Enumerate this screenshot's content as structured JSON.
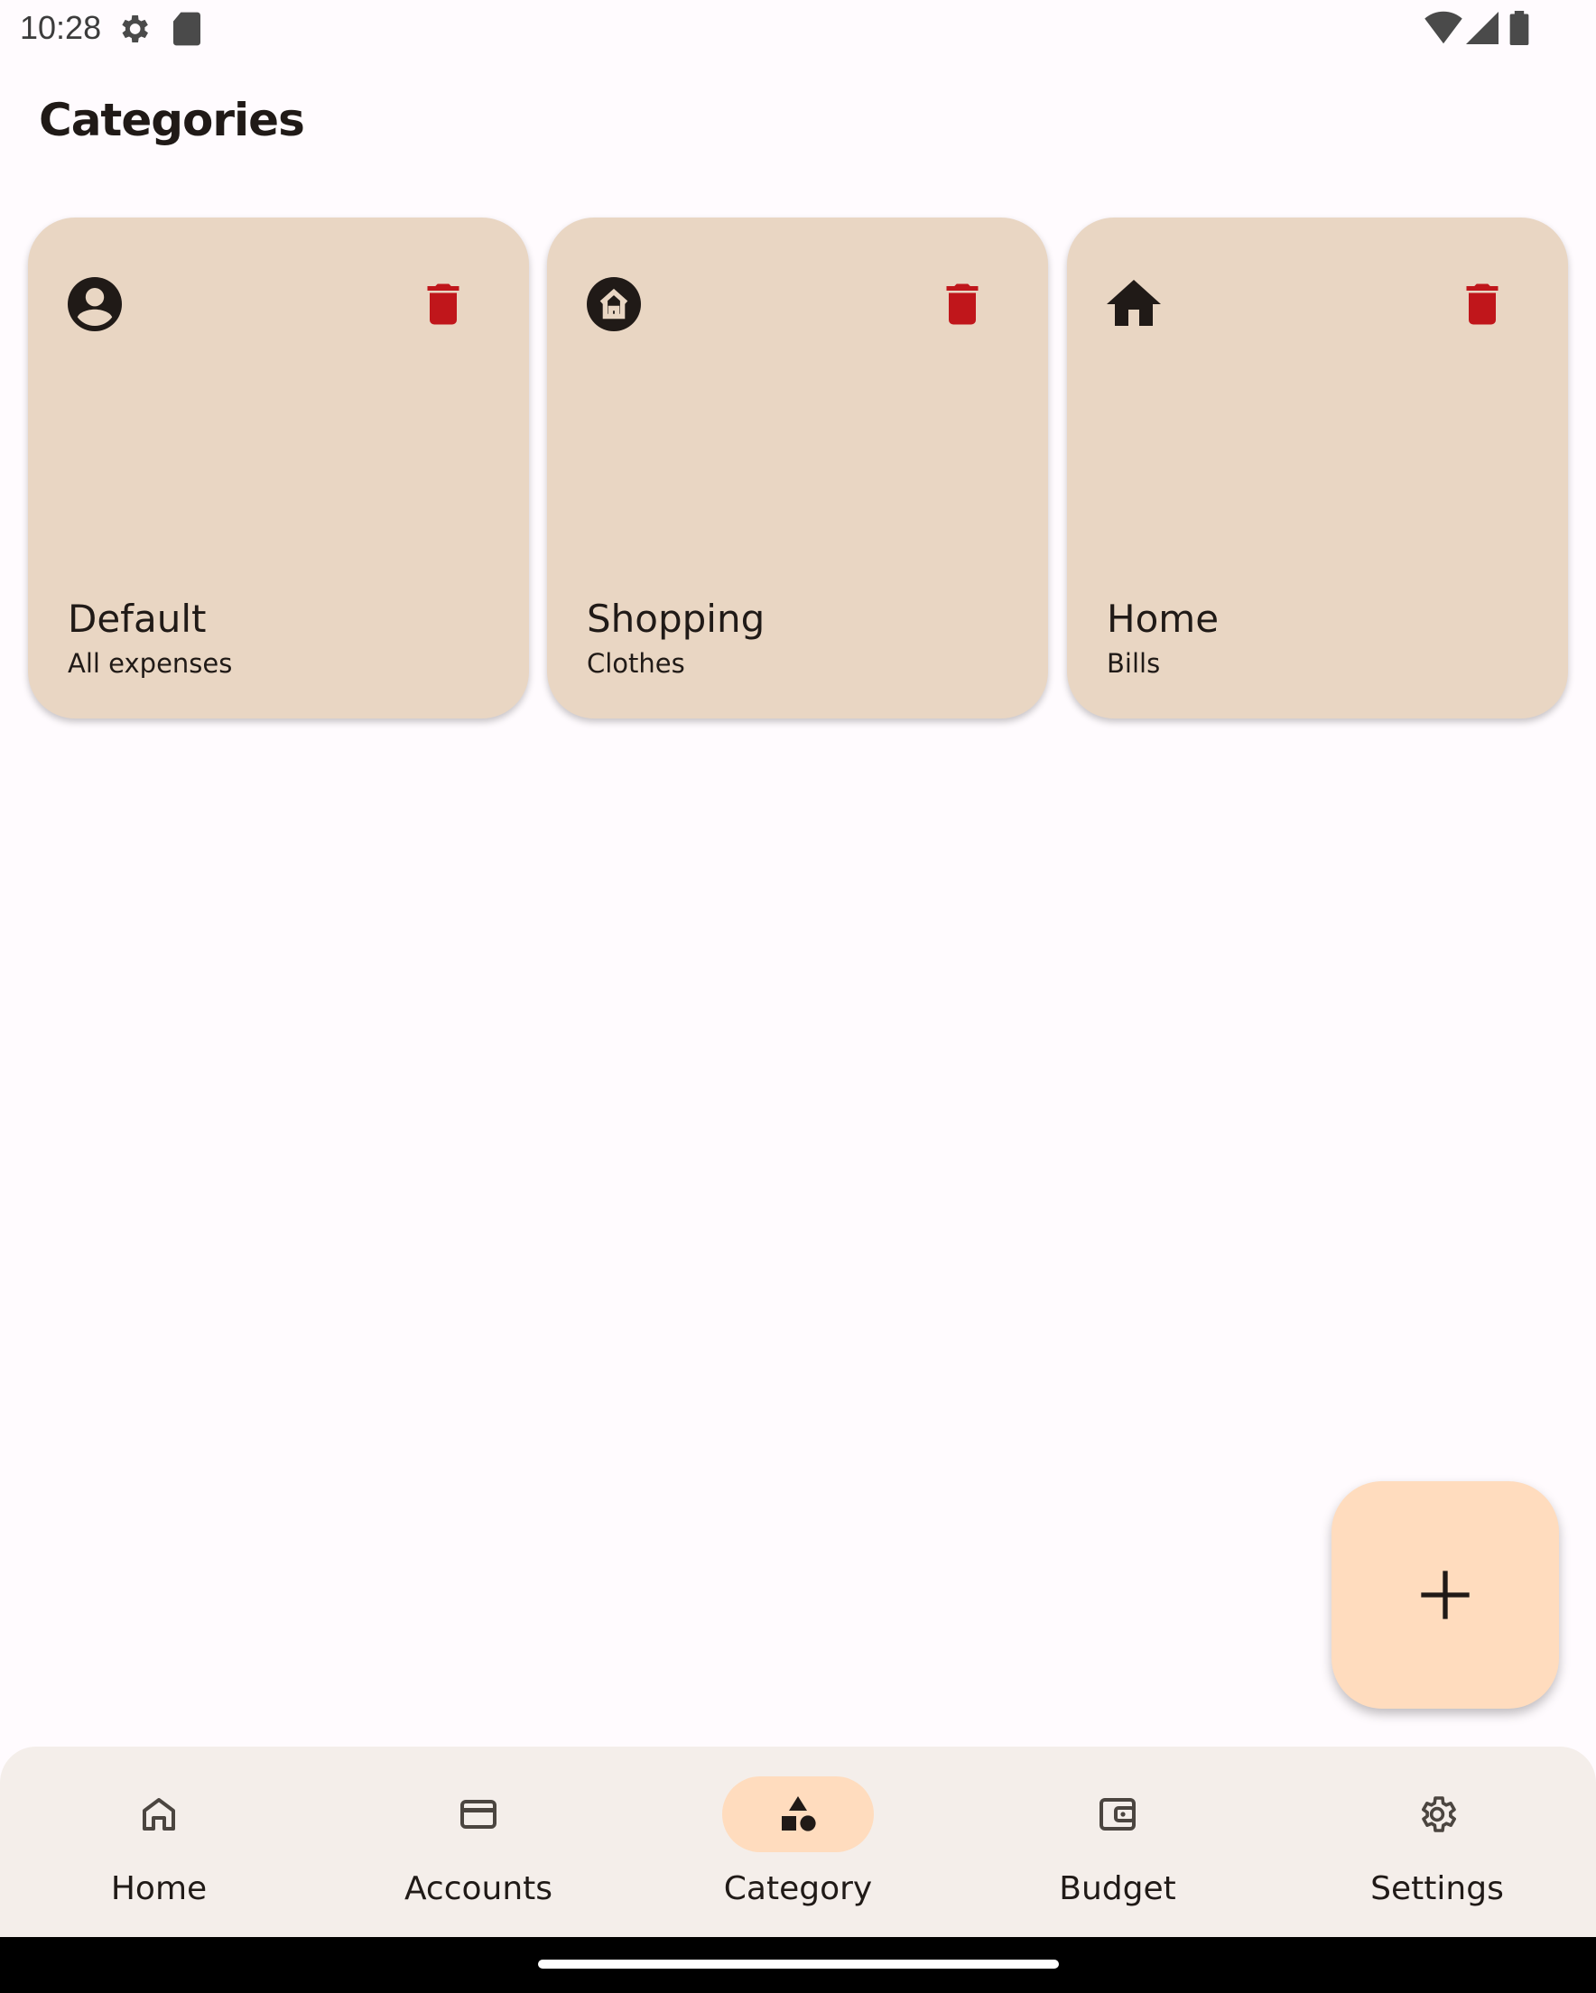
{
  "status_bar": {
    "time": "10:28",
    "icons": [
      "settings-gear-icon",
      "sd-card-icon",
      "wifi-icon",
      "signal-icon",
      "battery-icon"
    ]
  },
  "page": {
    "title": "Categories"
  },
  "categories": [
    {
      "name": "Default",
      "subtitle": "All expenses",
      "icon": "account-circle-icon"
    },
    {
      "name": "Shopping",
      "subtitle": "Clothes",
      "icon": "home-circle-icon"
    },
    {
      "name": "Home",
      "subtitle": "Bills",
      "icon": "home-icon"
    }
  ],
  "fab": {
    "icon": "plus-icon"
  },
  "bottom_nav": {
    "items": [
      {
        "label": "Home",
        "icon": "home-outline-icon",
        "active": false
      },
      {
        "label": "Accounts",
        "icon": "credit-card-icon",
        "active": false
      },
      {
        "label": "Category",
        "icon": "category-shapes-icon",
        "active": true
      },
      {
        "label": "Budget",
        "icon": "wallet-icon",
        "active": false
      },
      {
        "label": "Settings",
        "icon": "settings-icon",
        "active": false
      }
    ]
  },
  "colors": {
    "background": "#fffbfe",
    "card": "#e9d6c3",
    "delete": "#c0161b",
    "fab": "#ffdcbe",
    "nav_bar": "#f4eeea",
    "nav_active_pill": "#ffdcbe",
    "text": "#201a17"
  }
}
